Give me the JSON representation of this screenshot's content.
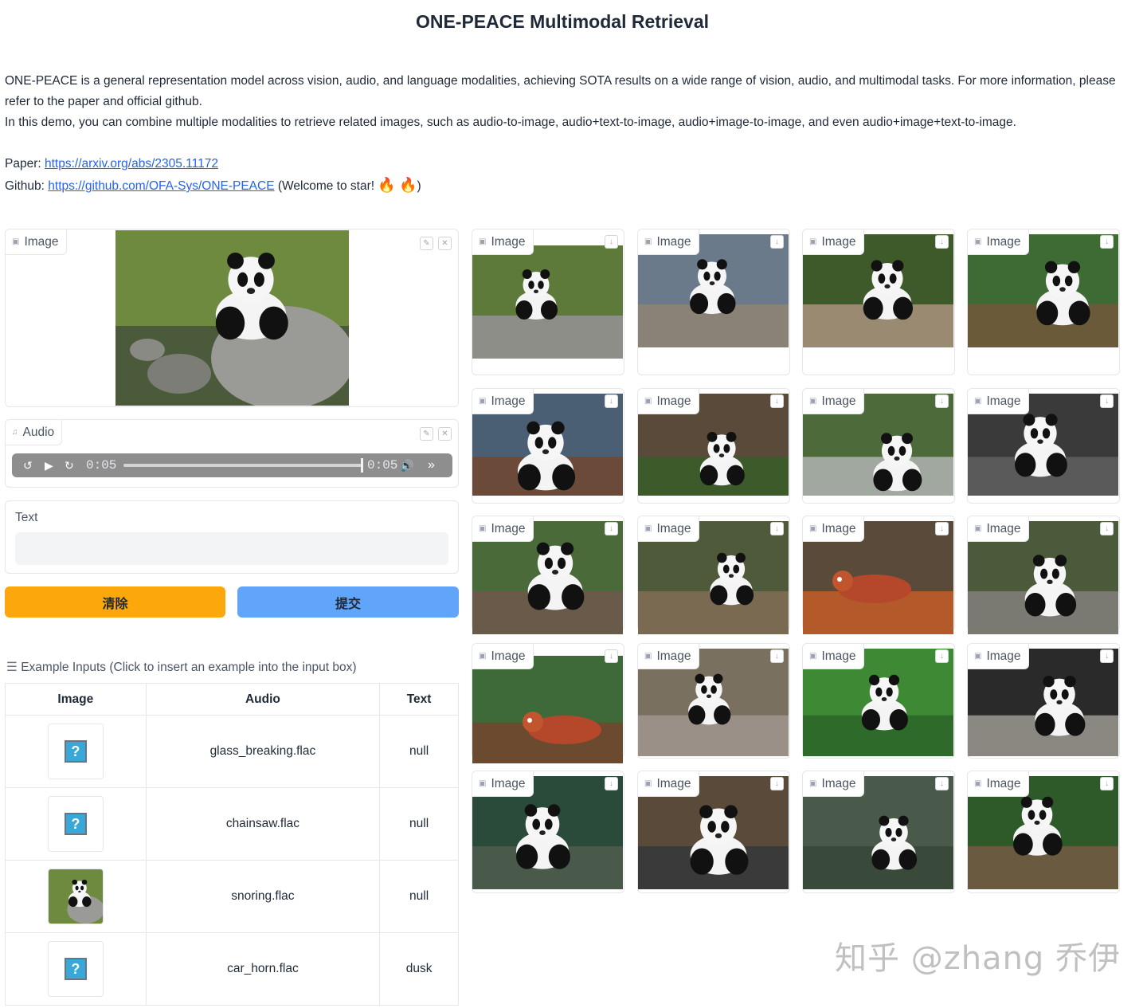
{
  "page": {
    "title": "ONE-PEACE Multimodal Retrieval",
    "description_1": "ONE-PEACE is a general representation model across vision, audio, and language modalities, achieving SOTA results on a wide range of vision, audio, and multimodal tasks. For more information, please refer to the paper and official github.",
    "description_2": "In this demo, you can combine multiple modalities to retrieve related images, such as audio-to-image, audio+text-to-image, audio+image-to-image, and even audio+image+text-to-image.",
    "paper_prefix": "Paper:",
    "paper_link": "https://arxiv.org/abs/2305.11172",
    "github_prefix": "Github:",
    "github_link": "https://github.com/OFA-Sys/ONE-PEACE",
    "github_suffix_open": "(Welcome to star!",
    "github_suffix_close": ")",
    "fire_glyph": "🔥"
  },
  "inputs": {
    "image_label": "Image",
    "audio_label": "Audio",
    "audio_current_time": "0:05",
    "audio_duration": "0:05",
    "audio_progress": 1.0,
    "text_label": "Text",
    "text_value": "",
    "clear_label": "清除",
    "submit_label": "提交"
  },
  "icons": {
    "image_tag": "image-icon",
    "audio_tag": "music-note-icon",
    "edit": "pencil-icon",
    "close": "close-icon",
    "download": "download-icon",
    "rewind": "rewind-icon",
    "play": "play-icon",
    "forward": "forward-icon",
    "volume": "volume-icon",
    "speed": "double-chevron-icon"
  },
  "examples": {
    "header": "Example Inputs (Click to insert an example into the input box)",
    "columns": [
      "Image",
      "Audio",
      "Text"
    ],
    "rows": [
      {
        "image": "broken",
        "audio": "glass_breaking.flac",
        "text": "null"
      },
      {
        "image": "broken",
        "audio": "chainsaw.flac",
        "text": "null"
      },
      {
        "image": "panda",
        "audio": "snoring.flac",
        "text": "null"
      },
      {
        "image": "broken",
        "audio": "car_horn.flac",
        "text": "dusk"
      }
    ]
  },
  "results": {
    "label": "Image",
    "count": 20
  },
  "colors": {
    "clear_button": "#fca80c",
    "submit_button": "#60a5fa",
    "link": "#2563eb"
  },
  "watermark": "知乎 @zhang 乔伊"
}
